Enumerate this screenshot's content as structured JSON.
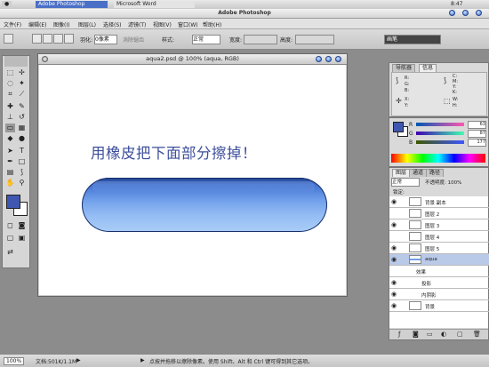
{
  "system_bar": {
    "tab1": "Adobe Photoshop",
    "tab2": "Microsoft Word",
    "time": "8:47"
  },
  "window_title": "Adobe Photoshop",
  "menu": [
    "文件(F)",
    "编辑(E)",
    "图像(I)",
    "图层(L)",
    "选择(S)",
    "滤镜(T)",
    "视图(V)",
    "窗口(W)",
    "帮助(H)"
  ],
  "options": {
    "feather_label": "羽化:",
    "feather_value": "0像素",
    "antialias_label": "消除锯齿",
    "style_label": "样式:",
    "style_value": "正常",
    "width_label": "宽度:",
    "height_label": "高度:",
    "brush_panel": "画笔"
  },
  "document": {
    "title": "aqua2.psd @ 100% (aqua, RGB)",
    "canvas_text": "用橡皮把下面部分擦掉！"
  },
  "navigator": {
    "tabs": [
      "导航器",
      "信息"
    ],
    "rgb": [
      "R:",
      "G:",
      "B:"
    ],
    "cmyk": [
      "C:",
      "M:",
      "Y:",
      "K:"
    ],
    "xy": [
      "X:",
      "Y:"
    ],
    "wh": [
      "W:",
      "H:"
    ]
  },
  "color_panel": {
    "channels": [
      "R",
      "G",
      "B"
    ],
    "values": [
      "63",
      "87",
      "177"
    ]
  },
  "layers_panel": {
    "tabs": [
      "图层",
      "通道",
      "路径"
    ],
    "mode": "正常",
    "opacity": "不透明度: 100%",
    "lock": "锁定:",
    "layers": [
      "背景 副本",
      "图层 2",
      "图层 3",
      "图层 4",
      "图层 5",
      "aqua",
      "效果",
      "投影",
      "内阴影",
      "背景"
    ]
  },
  "status": {
    "zoom": "100%",
    "doc": "文档:501K/1.1M",
    "hint": "点按并拖移以擦除像素。使用 Shift、Alt 和 Ctrl 键可得到其它选项。"
  },
  "colors": {
    "accent": "#3566c8",
    "canvas_text": "#3d4f9c",
    "foreground": "#3f57b1",
    "background": "#ffffff"
  }
}
